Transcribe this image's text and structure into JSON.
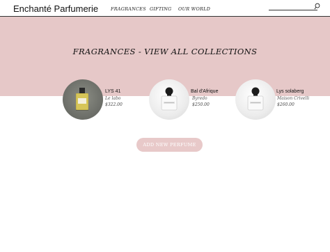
{
  "header": {
    "brand": "Enchanté Parfumerie",
    "nav": [
      "FRAGRANCES",
      "GIFTING",
      "OUR WORLD"
    ],
    "search_icon": "search-icon"
  },
  "hero": {
    "title": "FRAGRANCES - VIEW ALL COLLECTIONS",
    "background_color": "#e6c8c8"
  },
  "products": [
    {
      "name": "LYS 41",
      "brand": "Le labo",
      "price": "$322.00",
      "image": "perfume-bottle-amber"
    },
    {
      "name": "Bal d'Afrique",
      "brand": "Byredo",
      "price": "$250.00",
      "image": "perfume-bottle-byredo"
    },
    {
      "name": "Lys solaberg",
      "brand": "Maison Crivelli",
      "price": "$260.00",
      "image": "perfume-bottle-byredo"
    }
  ],
  "actions": {
    "add_label": "ADD NEW PERFUME",
    "button_color": "#e8c9c9"
  }
}
